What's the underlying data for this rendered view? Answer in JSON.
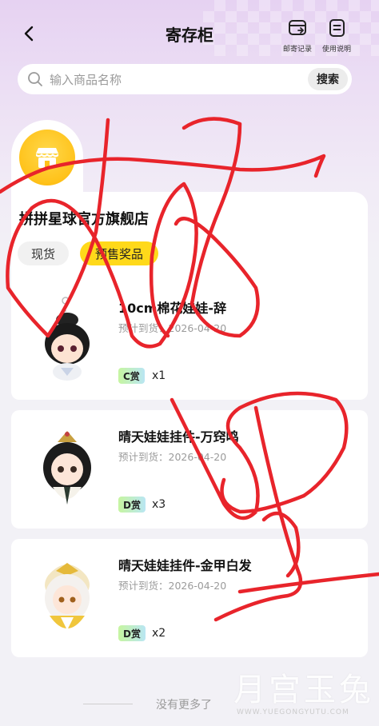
{
  "header": {
    "title": "寄存柜",
    "actions": [
      {
        "label": "邮寄记录",
        "icon": "mail-record-icon"
      },
      {
        "label": "使用说明",
        "icon": "document-icon"
      }
    ]
  },
  "search": {
    "placeholder": "输入商品名称",
    "button_label": "搜索"
  },
  "store": {
    "name": "拼拼星球官方旗舰店",
    "tabs": [
      {
        "label": "现货",
        "selected": false
      },
      {
        "label": "预售奖品",
        "selected": true
      }
    ]
  },
  "items": [
    {
      "title": "10cm棉花娃娃-辞",
      "date_label": "预计到货：",
      "date": "2026-04-20",
      "grade": "C赏",
      "qty": "x1",
      "icon": "plush-doll-black-hair-icon"
    },
    {
      "title": "晴天娃娃挂件-万窍鸣",
      "date_label": "预计到货：",
      "date": "2026-04-20",
      "grade": "D赏",
      "qty": "x3",
      "icon": "doll-charm-dark-hair-icon"
    },
    {
      "title": "晴天娃娃挂件-金甲白发",
      "date_label": "预计到货：",
      "date": "2026-04-20",
      "grade": "D赏",
      "qty": "x2",
      "icon": "doll-charm-gold-armor-icon"
    }
  ],
  "footer": {
    "text": "没有更多了"
  },
  "watermark": {
    "cn": "月宫玉兔",
    "en": "WWW.YUEGONGYUTU.COM"
  },
  "colors": {
    "accent": "#ffd91a",
    "logo": "#ffc21a",
    "scribble": "#e8242b"
  }
}
